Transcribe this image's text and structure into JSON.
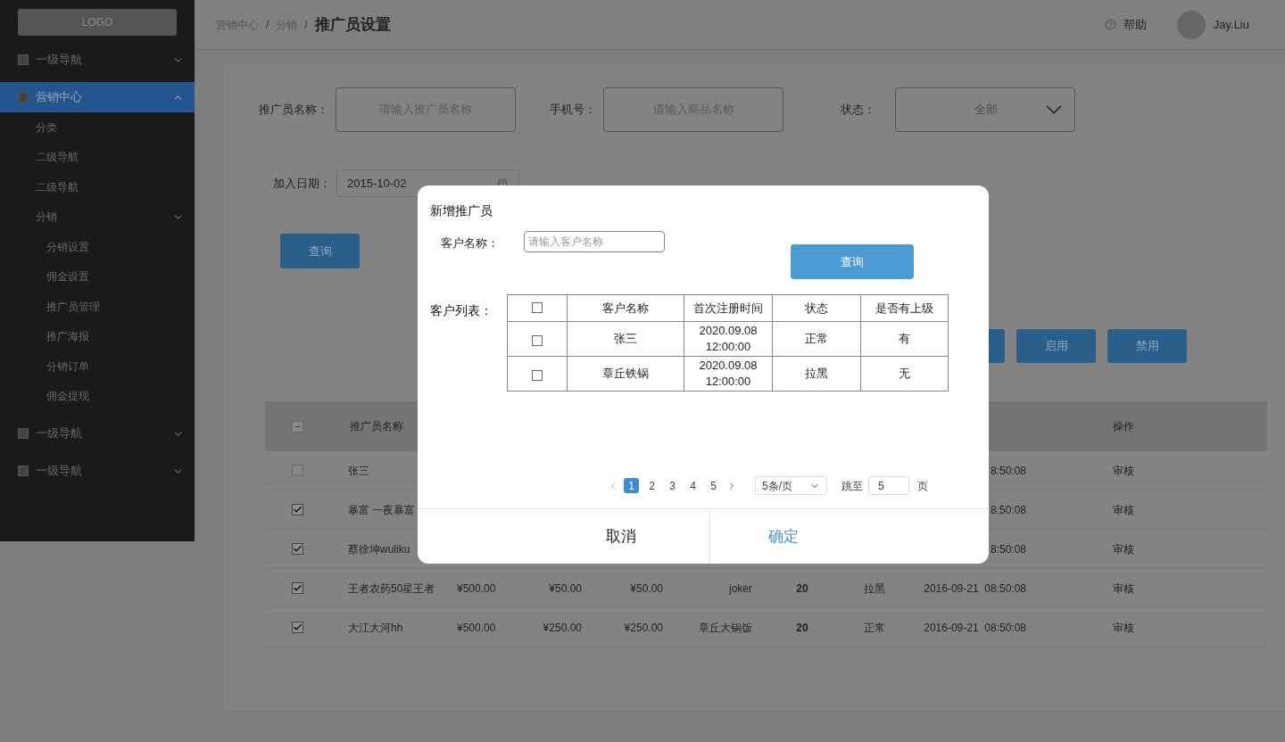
{
  "sidebar": {
    "logo": "LOGO",
    "items": [
      {
        "label": "一级导航",
        "selected": false,
        "expanded": false
      },
      {
        "label": "营销中心",
        "selected": true,
        "expanded": true,
        "children": [
          {
            "label": "分类"
          },
          {
            "label": "二级导航"
          },
          {
            "label": "二级导航"
          },
          {
            "label": "分销",
            "expanded": true,
            "children": [
              {
                "label": "分销设置"
              },
              {
                "label": "佣金设置"
              },
              {
                "label": "推广员管理"
              },
              {
                "label": "推广海报"
              },
              {
                "label": "分销订单"
              },
              {
                "label": "佣金提现"
              }
            ]
          }
        ]
      },
      {
        "label": "一级导航",
        "selected": false,
        "expanded": false
      },
      {
        "label": "一级导航",
        "selected": false,
        "expanded": false
      }
    ]
  },
  "header": {
    "breadcrumb": [
      "营销中心",
      "分销"
    ],
    "separator": "/",
    "title": "推广员设置",
    "help": "帮助",
    "user": "Jay.Liu"
  },
  "filters": [
    {
      "kind": "input",
      "label": "推广员名称：",
      "placeholder": "请输入推广员名称"
    },
    {
      "kind": "input",
      "label": "手机号：",
      "placeholder": "请输入商品名称"
    },
    {
      "kind": "select",
      "label": "状态：",
      "value": "全部"
    }
  ],
  "date_filter": {
    "label": "加入日期：",
    "value": "2015-10-02"
  },
  "query_button": "查询",
  "action_buttons": [
    "启用",
    "禁用"
  ],
  "table": {
    "header_indeterminate": true,
    "columns": [
      "推广员名称",
      "操作"
    ],
    "rows": [
      {
        "checked": false,
        "name": "张三",
        "time": "8:50:08",
        "action": "审核"
      },
      {
        "checked": true,
        "name": "暴富 一夜暴富",
        "time": "8:50:08",
        "action": "审核"
      },
      {
        "checked": true,
        "name": "蔡徐坤wuliku",
        "time": "8:50:08",
        "action": "审核"
      },
      {
        "checked": true,
        "name": "王者农药50星王者",
        "cells": [
          "¥500.00",
          "¥50.00",
          "¥50.00",
          "joker",
          "20",
          "拉黑"
        ],
        "time": "2016-09-21  08:50:08",
        "action": "审核"
      },
      {
        "checked": true,
        "name": "大江大河hh",
        "cells": [
          "¥500.00",
          "¥250.00",
          "¥250.00",
          "章丘大锅饭",
          "20",
          "正常"
        ],
        "time": "2016-09-21  08:50:08",
        "action": "审核"
      }
    ]
  },
  "dialog": {
    "title": "新增推广员",
    "field_label": "客户名称：",
    "placeholder": "请输入客户名称",
    "query_button": "查询",
    "list_label": "客户列表：",
    "table": {
      "header_checked": false,
      "columns": [
        "客户名称",
        "首次注册时间",
        "状态",
        "是否有上级"
      ],
      "rows": [
        {
          "checked": false,
          "cells": [
            "张三",
            "2020.09.08 12:00:00",
            "正常",
            "有"
          ]
        },
        {
          "checked": false,
          "cells": [
            "章丘铁锅",
            "2020.09.08 12:00:00",
            "拉黑",
            "无"
          ]
        }
      ]
    },
    "pagination": {
      "pages": [
        {
          "label": "1",
          "selected": true
        },
        {
          "label": "2",
          "selected": false
        },
        {
          "label": "3",
          "selected": false
        },
        {
          "label": "4",
          "selected": false
        },
        {
          "label": "5",
          "selected": false
        }
      ],
      "page_size": "5条/页",
      "jump_label": "跳至",
      "jump_value": "5",
      "page_suffix": "页"
    },
    "cancel": "取消",
    "confirm": "确定"
  }
}
